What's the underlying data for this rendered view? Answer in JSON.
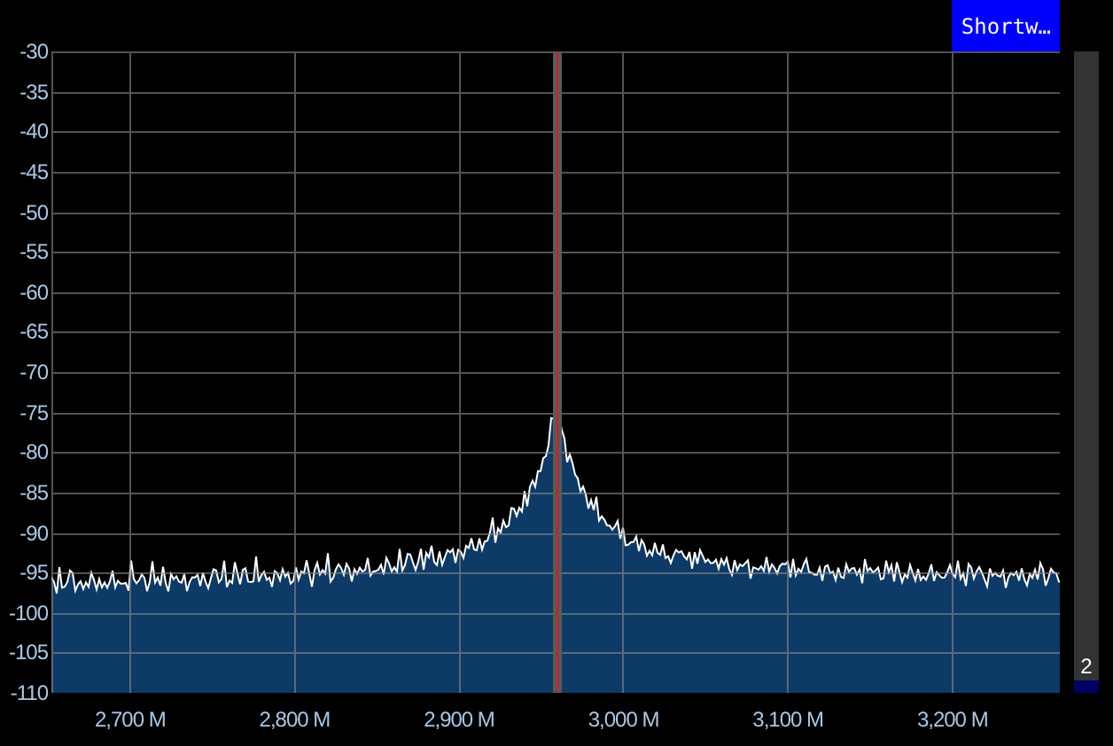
{
  "band_label": {
    "text": "Shortw…"
  },
  "y_axis": {
    "labels": [
      "-30",
      "-35",
      "-40",
      "-45",
      "-50",
      "-55",
      "-60",
      "-65",
      "-70",
      "-75",
      "-80",
      "-85",
      "-90",
      "-95",
      "-100",
      "-105",
      "-110"
    ]
  },
  "x_axis": {
    "labels": [
      "2,700 M",
      "2,800 M",
      "2,900 M",
      "3,000 M",
      "3,100 M",
      "3,200 M"
    ]
  },
  "signal_meter": {
    "reading": "2",
    "level": 0.02
  }
}
